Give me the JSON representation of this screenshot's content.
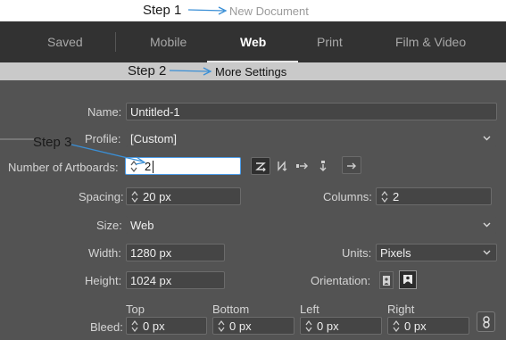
{
  "annotations": {
    "step1": "Step 1",
    "step2": "Step 2",
    "step3": "Step 3"
  },
  "window": {
    "title": "New Document"
  },
  "tabs": [
    {
      "label": "Saved",
      "active": false
    },
    {
      "label": "Mobile",
      "active": false
    },
    {
      "label": "Web",
      "active": true
    },
    {
      "label": "Print",
      "active": false
    },
    {
      "label": "Film & Video",
      "active": false
    }
  ],
  "more_settings": {
    "label": "More Settings"
  },
  "form": {
    "name": {
      "label": "Name:",
      "value": "Untitled-1"
    },
    "profile": {
      "label": "Profile:",
      "value": "[Custom]"
    },
    "artboards": {
      "label": "Number of Artboards:",
      "value": "2"
    },
    "spacing": {
      "label": "Spacing:",
      "value": "20 px"
    },
    "columns": {
      "label": "Columns:",
      "value": "2"
    },
    "size": {
      "label": "Size:",
      "value": "Web"
    },
    "width": {
      "label": "Width:",
      "value": "1280 px"
    },
    "units": {
      "label": "Units:",
      "value": "Pixels"
    },
    "height": {
      "label": "Height:",
      "value": "1024 px"
    },
    "orientation": {
      "label": "Orientation:",
      "selected": "landscape"
    },
    "bleed": {
      "label": "Bleed:",
      "top": {
        "label": "Top",
        "value": "0 px"
      },
      "bottom": {
        "label": "Bottom",
        "value": "0 px"
      },
      "left": {
        "label": "Left",
        "value": "0 px"
      },
      "right": {
        "label": "Right",
        "value": "0 px"
      }
    }
  },
  "artboard_layout_icons": [
    "grid-by-row-icon",
    "grid-by-column-icon",
    "arrange-by-row-icon",
    "arrange-by-column-icon",
    "right-to-left-icon"
  ],
  "colors": {
    "panel_bg": "#535353",
    "tabbar_bg": "#323232",
    "annotation_arrow": "#3a8fd6",
    "focus_border": "#4a9be8"
  }
}
